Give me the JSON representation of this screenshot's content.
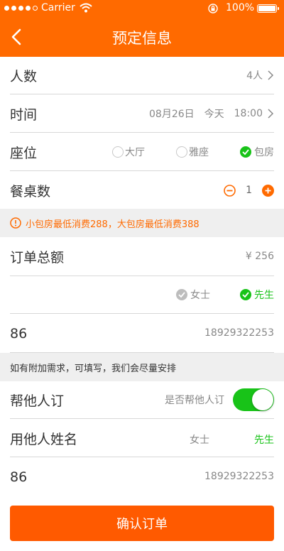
{
  "status_bar": {
    "carrier": "Carrier",
    "battery": "100%"
  },
  "nav": {
    "title": "预定信息"
  },
  "people": {
    "label": "人数",
    "value": "4人"
  },
  "time": {
    "label": "时间",
    "date": "08月26日",
    "day": "今天",
    "clock": "18:00"
  },
  "seat": {
    "label": "座位",
    "options": [
      "大厅",
      "雅座",
      "包房"
    ],
    "selected": "包房"
  },
  "tables": {
    "label": "餐桌数",
    "count": "1"
  },
  "notice": {
    "text": "小包房最低消费288，大包房最低消费388"
  },
  "total": {
    "label": "订单总额",
    "value": "¥ 256"
  },
  "gender": {
    "options": [
      "女士",
      "先生"
    ],
    "selected": "先生"
  },
  "phone": {
    "code": "86",
    "number": "18929322253"
  },
  "remark_hint": {
    "text": "如有附加需求，可填写，我们会尽量安排"
  },
  "help": {
    "label": "帮他人订",
    "toggle_label": "是否帮他人订",
    "enabled": true
  },
  "other_name": {
    "label": "用他人姓名",
    "options": [
      "女士",
      "先生"
    ],
    "selected": "先生"
  },
  "other_phone": {
    "code": "86",
    "number": "18929322253"
  },
  "confirm_button": {
    "label": "确认订单"
  },
  "colors": {
    "brand": "#ff6a00",
    "button": "#ff5a00",
    "success": "#18c318",
    "gray": "#888888"
  }
}
